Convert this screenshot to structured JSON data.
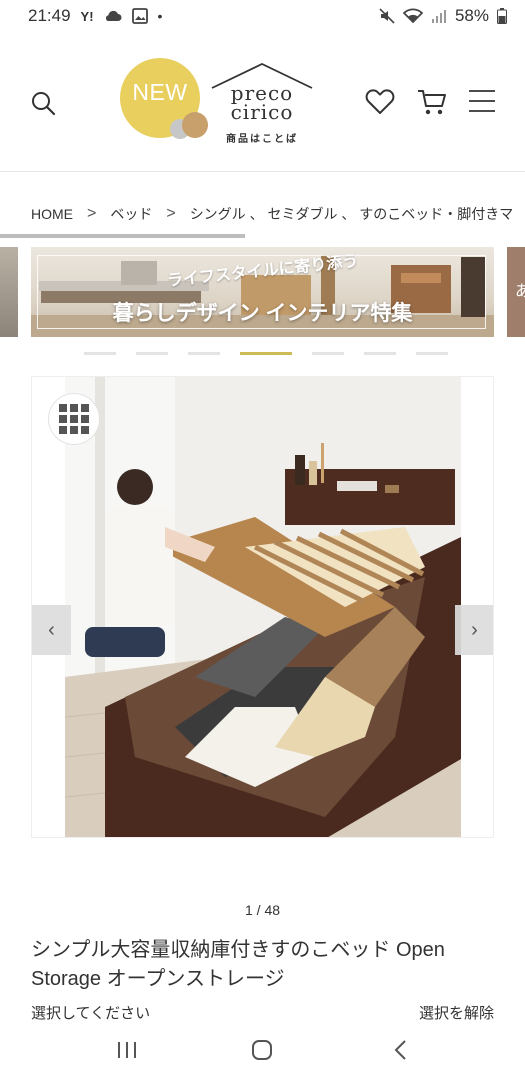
{
  "status_bar": {
    "time": "21:49",
    "carrier_glyph": "Y!",
    "battery": "58%",
    "icons": [
      "cloud-icon",
      "image-icon",
      "dot-icon",
      "mute-icon",
      "wifi-icon",
      "signal-icon",
      "battery-icon"
    ]
  },
  "header": {
    "logo_badge": "NEW",
    "logo_brand_line1": "preco",
    "logo_brand_line2": "cirico",
    "logo_tagline": "商品はことば",
    "icons": [
      "search-icon",
      "heart-icon",
      "cart-icon",
      "menu-icon"
    ]
  },
  "breadcrumb": {
    "items": [
      "HOME",
      "ベッド",
      "シングル 、 セミダブル 、 すのこベッド・脚付きマ"
    ],
    "separator": ">"
  },
  "banner": {
    "subtitle": "ライフスタイルに寄り添う",
    "title": "暮らしデザイン インテリア特集"
  },
  "carousel": {
    "dot_count": 7,
    "active_dot": 3,
    "active_color": "#cdbb55"
  },
  "gallery": {
    "counter": "1 / 48",
    "prev_glyph": "‹",
    "next_glyph": "›"
  },
  "product": {
    "title": "シンプル大容量収納庫付きすのこベッド Open Storage オープンストレージ",
    "select_prompt": "選択してください",
    "clear_label": "選択を解除"
  },
  "colors": {
    "accent": "#e9cf5d",
    "text": "#333333",
    "brown": "#4e2c20"
  }
}
